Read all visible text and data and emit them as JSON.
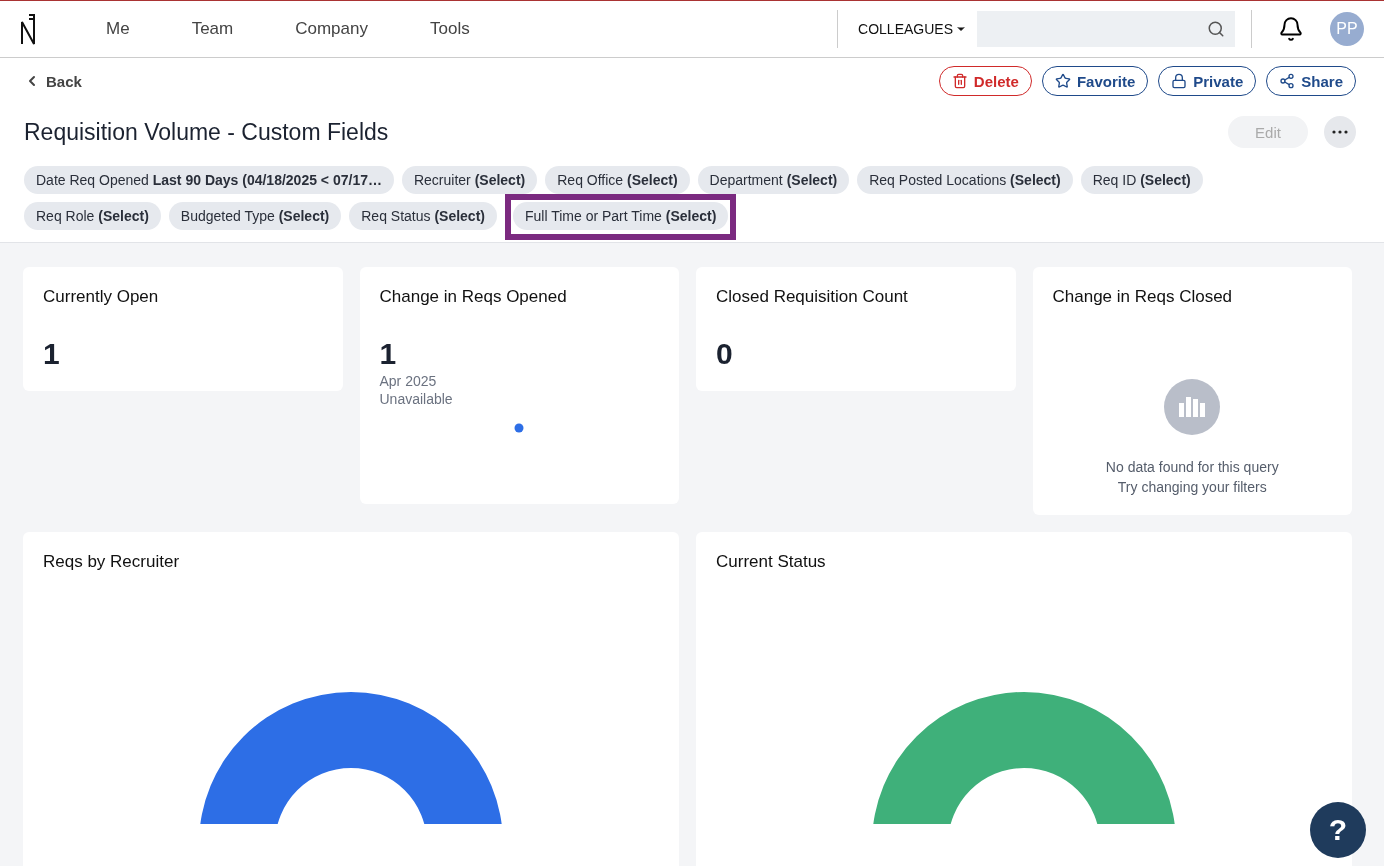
{
  "nav": {
    "items": [
      {
        "label": "Me"
      },
      {
        "label": "Team"
      },
      {
        "label": "Company"
      },
      {
        "label": "Tools"
      }
    ],
    "scope": "COLLEAGUES",
    "avatar": "PP"
  },
  "back": "Back",
  "actions": [
    {
      "label": "Delete",
      "kind": "danger"
    },
    {
      "label": "Favorite",
      "kind": "star"
    },
    {
      "label": "Private",
      "kind": "lock"
    },
    {
      "label": "Share",
      "kind": "share"
    }
  ],
  "title": "Requisition Volume - Custom Fields",
  "edit": {
    "label": "Edit",
    "disabled": true
  },
  "filters": [
    {
      "label": "Date Req Opened",
      "value": "Last 90 Days (04/18/2025 < 07/17…",
      "highlighted": false
    },
    {
      "label": "Recruiter",
      "value": "(Select)",
      "highlighted": false
    },
    {
      "label": "Req Office",
      "value": "(Select)",
      "highlighted": false
    },
    {
      "label": "Department",
      "value": "(Select)",
      "highlighted": false
    },
    {
      "label": "Req Posted Locations",
      "value": "(Select)",
      "highlighted": false
    },
    {
      "label": "Req ID",
      "value": "(Select)",
      "highlighted": false
    },
    {
      "label": "Req Role",
      "value": "(Select)",
      "highlighted": false
    },
    {
      "label": "Budgeted Type",
      "value": "(Select)",
      "highlighted": false
    },
    {
      "label": "Req Status",
      "value": "(Select)",
      "highlighted": false
    },
    {
      "label": "Full Time or Part Time",
      "value": "(Select)",
      "highlighted": true
    }
  ],
  "stats": [
    {
      "kind": "number",
      "title": "Currently Open",
      "value": "1"
    },
    {
      "kind": "trend",
      "title": "Change in Reqs Opened",
      "value": "1",
      "period": "Apr 2025",
      "note": "Unavailable"
    },
    {
      "kind": "number",
      "title": "Closed Requisition Count",
      "value": "0"
    },
    {
      "kind": "empty",
      "title": "Change in Reqs Closed",
      "message": "No data found for this query",
      "hint": "Try changing your filters"
    }
  ],
  "charts": [
    {
      "title": "Reqs by Recruiter",
      "color": "#2d6ee6"
    },
    {
      "title": "Current Status",
      "color": "#3fb07a"
    }
  ],
  "help": "?"
}
